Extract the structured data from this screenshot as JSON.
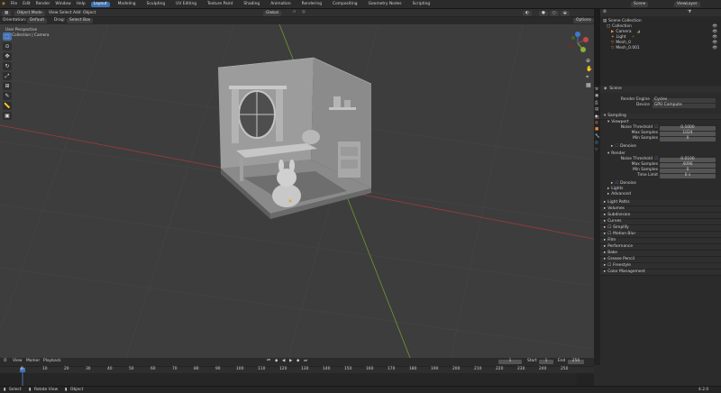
{
  "app": {
    "menus": [
      "File",
      "Edit",
      "Render",
      "Window",
      "Help"
    ],
    "workspaces": [
      "Layout",
      "Modeling",
      "Sculpting",
      "UV Editing",
      "Texture Paint",
      "Shading",
      "Animation",
      "Rendering",
      "Compositing",
      "Geometry Nodes",
      "Scripting"
    ],
    "active_workspace": "Layout",
    "scene_name": "Scene",
    "view_layer": "ViewLayer"
  },
  "viewport": {
    "mode": "Object Mode",
    "menus": [
      "View",
      "Select",
      "Add",
      "Object"
    ],
    "orientation_label": "Orientation:",
    "orientation_value": "Default",
    "drag_label": "Drag:",
    "drag_value": "Select Box",
    "pivot": "Global",
    "options": "Options",
    "overlay_title": "User Perspective",
    "overlay_sub": "(1) Collection | Camera",
    "gizmo_axes": [
      "X",
      "Y",
      "Z"
    ]
  },
  "outliner": {
    "title": "Scene Collection",
    "items": [
      {
        "label": "Collection",
        "icon": "collection-icon"
      },
      {
        "label": "Camera",
        "icon": "camera-icon"
      },
      {
        "label": "Light",
        "icon": "light-icon"
      },
      {
        "label": "Mesh_0",
        "icon": "mesh-icon"
      },
      {
        "label": "Mesh_0.001",
        "icon": "mesh-icon"
      }
    ]
  },
  "properties": {
    "context": "Scene",
    "render_engine_label": "Render Engine",
    "render_engine": "Cycles",
    "device_label": "Device",
    "device": "GPU Compute",
    "sampling": "Sampling",
    "viewport_section": "Viewport",
    "noise_threshold_label": "Noise Threshold",
    "vp_noise_threshold": "0.1000",
    "max_samples_label": "Max Samples",
    "vp_max_samples": "1024",
    "min_samples_label": "Min Samples",
    "vp_min_samples": "0",
    "denoise": "Denoise",
    "render_section": "Render",
    "r_noise_threshold": "0.0100",
    "r_max_samples": "4096",
    "r_min_samples": "0",
    "time_limit_label": "Time Limit",
    "r_time_limit": "0 s",
    "subpanels": [
      "Denoise",
      "Lights",
      "Advanced"
    ],
    "panels": [
      "Light Paths",
      "Volumes",
      "Subdivision",
      "Curves",
      "Simplify",
      "Motion Blur",
      "Film",
      "Performance",
      "Bake",
      "Grease Pencil",
      "Freestyle",
      "Color Management"
    ]
  },
  "timeline": {
    "menus": [
      "View",
      "Marker",
      "Playback"
    ],
    "ticks": [
      "0",
      "10",
      "20",
      "30",
      "40",
      "50",
      "60",
      "70",
      "80",
      "90",
      "100",
      "110",
      "120",
      "130",
      "140",
      "150",
      "160",
      "170",
      "180",
      "190",
      "200",
      "210",
      "220",
      "230",
      "240",
      "250"
    ],
    "current_frame": "1",
    "start_label": "Start",
    "start": "1",
    "end_label": "End",
    "end": "250"
  },
  "status": {
    "items": [
      "Select",
      "Rotate View",
      "Object"
    ],
    "version": "4.2.0"
  },
  "colors": {
    "accent": "#4772b3",
    "x_axis": "#b03a3a",
    "y_axis": "#7fa83a",
    "viewport_bg": "#3d3d3d"
  }
}
